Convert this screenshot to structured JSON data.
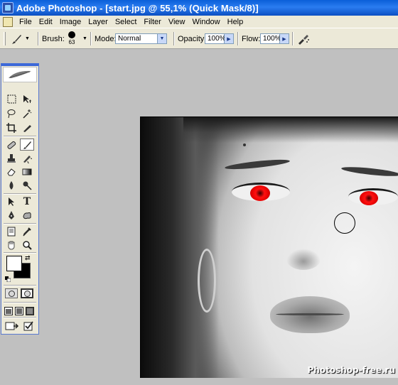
{
  "window": {
    "title": "Adobe Photoshop - [start.jpg @ 55,1% (Quick Mask/8)]"
  },
  "menu": {
    "items": [
      "File",
      "Edit",
      "Image",
      "Layer",
      "Select",
      "Filter",
      "View",
      "Window",
      "Help"
    ]
  },
  "options_bar": {
    "brush_label": "Brush:",
    "brush_size": "63",
    "mode_label": "Mode:",
    "mode_value": "Normal",
    "opacity_label": "Opacity:",
    "opacity_value": "100%",
    "flow_label": "Flow:",
    "flow_value": "100%"
  },
  "toolbox": {
    "tools": [
      "rectangular-marquee",
      "move",
      "lasso",
      "magic-wand",
      "crop",
      "slice",
      "healing-brush",
      "brush",
      "clone-stamp",
      "history-brush",
      "eraser",
      "gradient",
      "blur",
      "dodge",
      "path-selection",
      "type",
      "pen",
      "custom-shape",
      "notes",
      "eyedropper",
      "hand",
      "zoom"
    ],
    "type_glyph": "T",
    "foreground_color": "#ffffff",
    "background_color": "#000000",
    "active_tool": "brush"
  },
  "document": {
    "watermark": "Photoshop-free.ru",
    "eye_color": "#ff1010"
  }
}
